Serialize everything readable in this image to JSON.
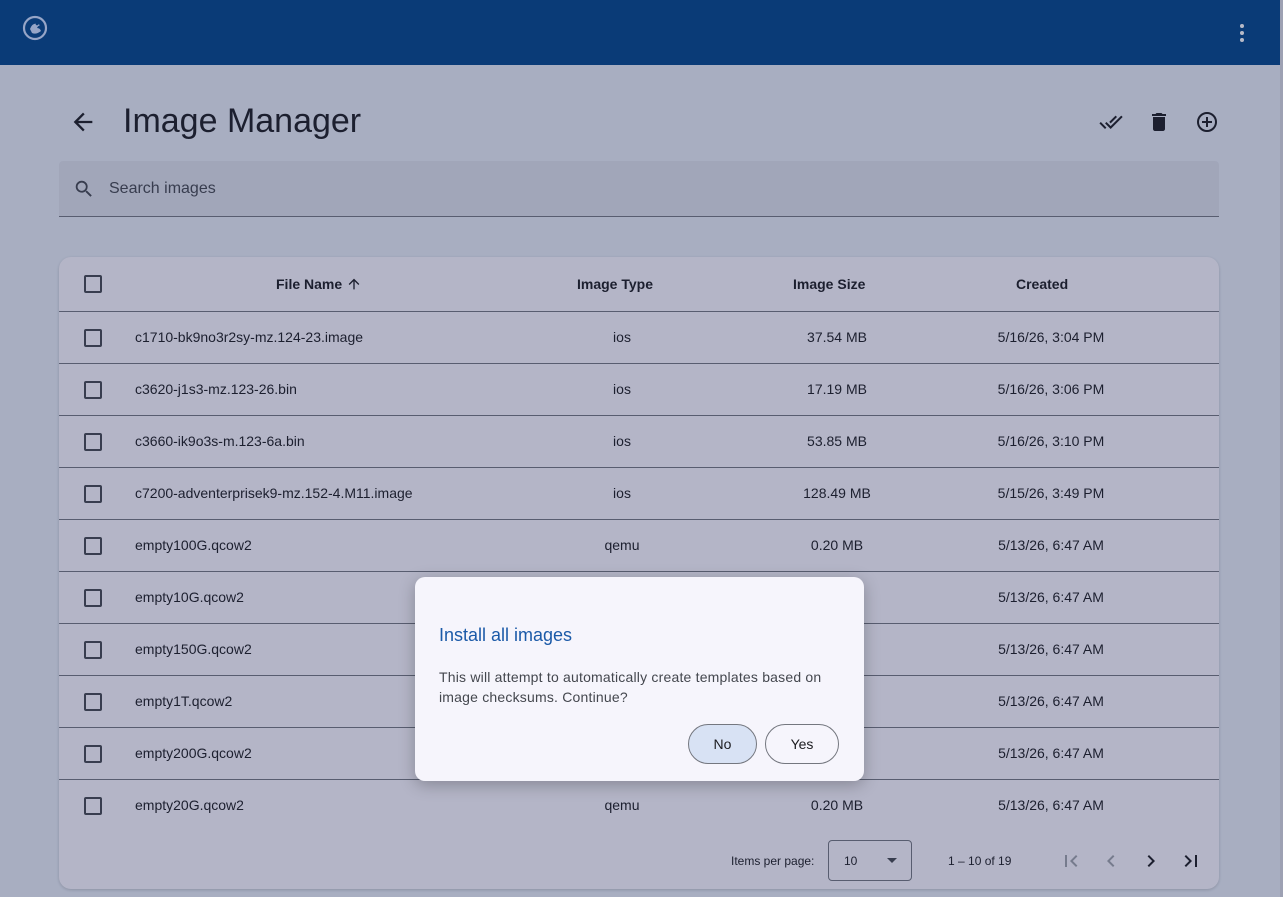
{
  "app": {
    "logo_icon": "chameleon-logo-icon",
    "more_icon": "more-vert-icon",
    "topbar_color": "#004489"
  },
  "header": {
    "title": "Image Manager",
    "back_icon": "arrow-back-icon",
    "actions": [
      "done-all-icon",
      "delete-icon",
      "add-circle-icon"
    ]
  },
  "search": {
    "placeholder": "Search images",
    "icon": "search-icon"
  },
  "table": {
    "columns": {
      "file_name": "File Name",
      "image_type": "Image Type",
      "image_size": "Image Size",
      "created": "Created"
    },
    "sort_icon": "arrow-upward-icon",
    "rows": [
      {
        "file_name": "c1710-bk9no3r2sy-mz.124-23.image",
        "image_type": "ios",
        "image_size": "37.54 MB",
        "created": "5/16/26, 3:04 PM"
      },
      {
        "file_name": "c3620-j1s3-mz.123-26.bin",
        "image_type": "ios",
        "image_size": "17.19 MB",
        "created": "5/16/26, 3:06 PM"
      },
      {
        "file_name": "c3660-ik9o3s-m.123-6a.bin",
        "image_type": "ios",
        "image_size": "53.85 MB",
        "created": "5/16/26, 3:10 PM"
      },
      {
        "file_name": "c7200-adventerprisek9-mz.152-4.M11.image",
        "image_type": "ios",
        "image_size": "128.49 MB",
        "created": "5/15/26, 3:49 PM"
      },
      {
        "file_name": "empty100G.qcow2",
        "image_type": "qemu",
        "image_size": "0.20 MB",
        "created": "5/13/26, 6:47 AM"
      },
      {
        "file_name": "empty10G.qcow2",
        "image_type": "",
        "image_size": "",
        "created": "5/13/26, 6:47 AM"
      },
      {
        "file_name": "empty150G.qcow2",
        "image_type": "",
        "image_size": "",
        "created": "5/13/26, 6:47 AM"
      },
      {
        "file_name": "empty1T.qcow2",
        "image_type": "",
        "image_size": "",
        "created": "5/13/26, 6:47 AM"
      },
      {
        "file_name": "empty200G.qcow2",
        "image_type": "",
        "image_size": "",
        "created": "5/13/26, 6:47 AM"
      },
      {
        "file_name": "empty20G.qcow2",
        "image_type": "qemu",
        "image_size": "0.20 MB",
        "created": "5/13/26, 6:47 AM"
      }
    ]
  },
  "paginator": {
    "items_per_page_label": "Items per page:",
    "page_size": "10",
    "range": "1 – 10 of 19",
    "icons": [
      "first-page-icon",
      "chevron-left-icon",
      "chevron-right-icon",
      "last-page-icon"
    ]
  },
  "dialog": {
    "title": "Install all images",
    "body": "This will attempt to automatically create templates based on image checksums. Continue?",
    "no_label": "No",
    "yes_label": "Yes"
  }
}
